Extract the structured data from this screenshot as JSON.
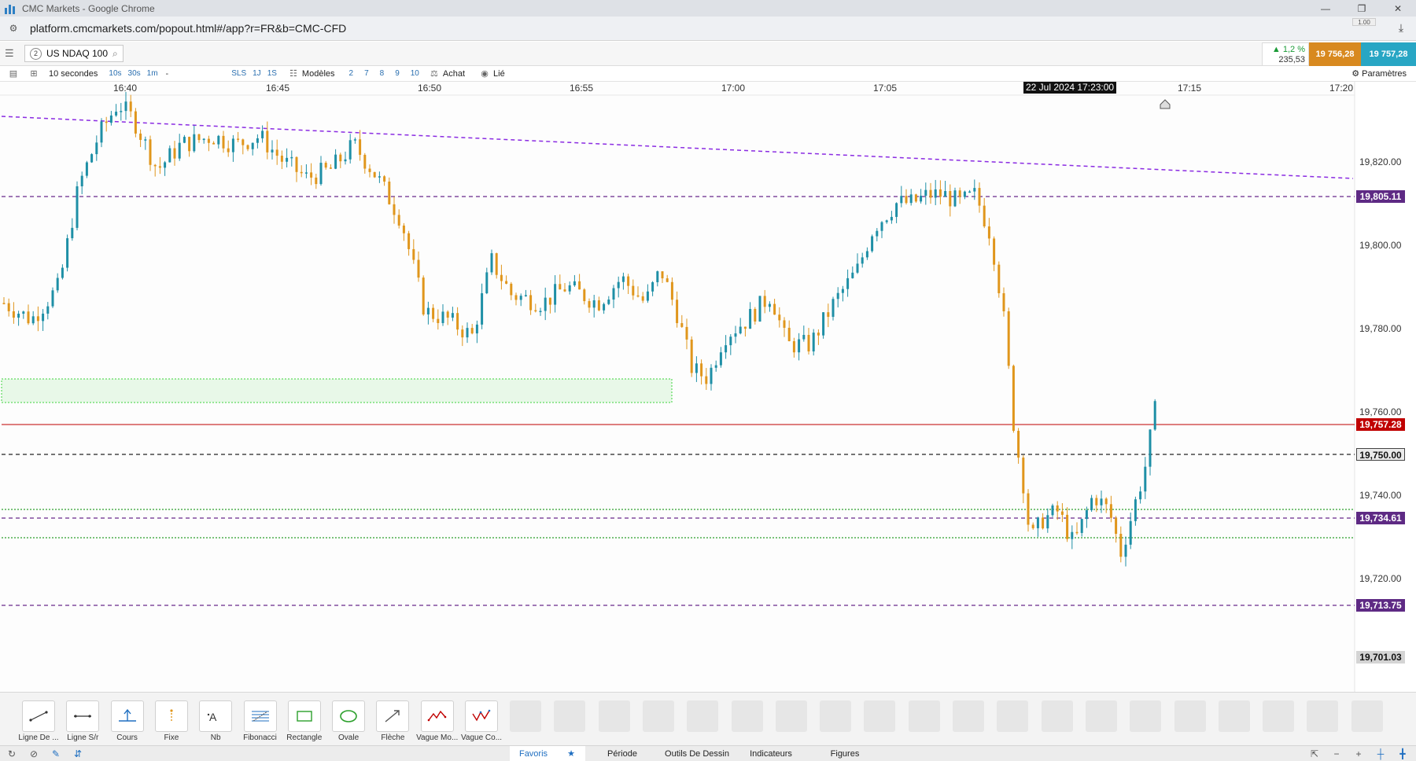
{
  "window": {
    "title": "CMC Markets - Google Chrome",
    "url": "platform.cmcmarkets.com/popout.html#/app?r=FR&b=CMC-CFD"
  },
  "instrument": {
    "slot": "2",
    "name": "US NDAQ 100",
    "change_pct": "▲ 1,2 %",
    "change_pts": "235,53",
    "bid": "19 756,28",
    "ask": "19 757,28",
    "spread": "1.00"
  },
  "chart_toolbar": {
    "interval": "10 secondes",
    "tf_10s": "10s",
    "tf_30s": "30s",
    "tf_1m": "1m",
    "tf_more": "-",
    "sls": "SLS",
    "d1": "1J",
    "s1": "1S",
    "models": "Modèles",
    "n2": "2",
    "n7": "7",
    "n8": "8",
    "n9": "9",
    "n10": "10",
    "buy": "Achat",
    "linked": "Lié",
    "settings": "Paramètres"
  },
  "x_axis": {
    "ticks": [
      "16:40",
      "16:45",
      "16:50",
      "16:55",
      "17:00",
      "17:05",
      "17:15",
      "17:20"
    ],
    "crosshair_date": "22 Jul 2024 17:23:00"
  },
  "y_axis": {
    "ticks": [
      "19,820.00",
      "19,800.00",
      "19,780.00",
      "19,760.00",
      "19,740.00",
      "19,720.00"
    ],
    "tags": {
      "resistance": "19,805.11",
      "current": "19,757.28",
      "level_750": "19,750.00",
      "support_1": "19,734.61",
      "support_2": "19,713.75",
      "low": "19,701.03"
    }
  },
  "drawing_tools": [
    {
      "label": "Ligne De ...",
      "icon": "trend-line-icon"
    },
    {
      "label": "Ligne S/r",
      "icon": "horizontal-line-icon"
    },
    {
      "label": "Cours",
      "icon": "price-line-icon"
    },
    {
      "label": "Fixe",
      "icon": "fixed-line-icon"
    },
    {
      "label": "Nb",
      "icon": "text-note-icon"
    },
    {
      "label": "Fibonacci",
      "icon": "fibonacci-icon"
    },
    {
      "label": "Rectangle",
      "icon": "rectangle-icon"
    },
    {
      "label": "Ovale",
      "icon": "oval-icon"
    },
    {
      "label": "Flèche",
      "icon": "arrow-icon"
    },
    {
      "label": "Vague Mo...",
      "icon": "wave-motive-icon"
    },
    {
      "label": "Vague Co...",
      "icon": "wave-corrective-icon"
    }
  ],
  "bottom_tabs": {
    "favorites": "Favoris",
    "period": "Période",
    "drawing": "Outils De Dessin",
    "indicators": "Indicateurs",
    "figures": "Figures"
  },
  "colors": {
    "bull": "#1e8fa6",
    "bear": "#e0961c",
    "trendline": "#8a2be2",
    "resistance": "#6a2a8c",
    "current": "#c00000",
    "support_zone": "#2ca02c"
  }
}
